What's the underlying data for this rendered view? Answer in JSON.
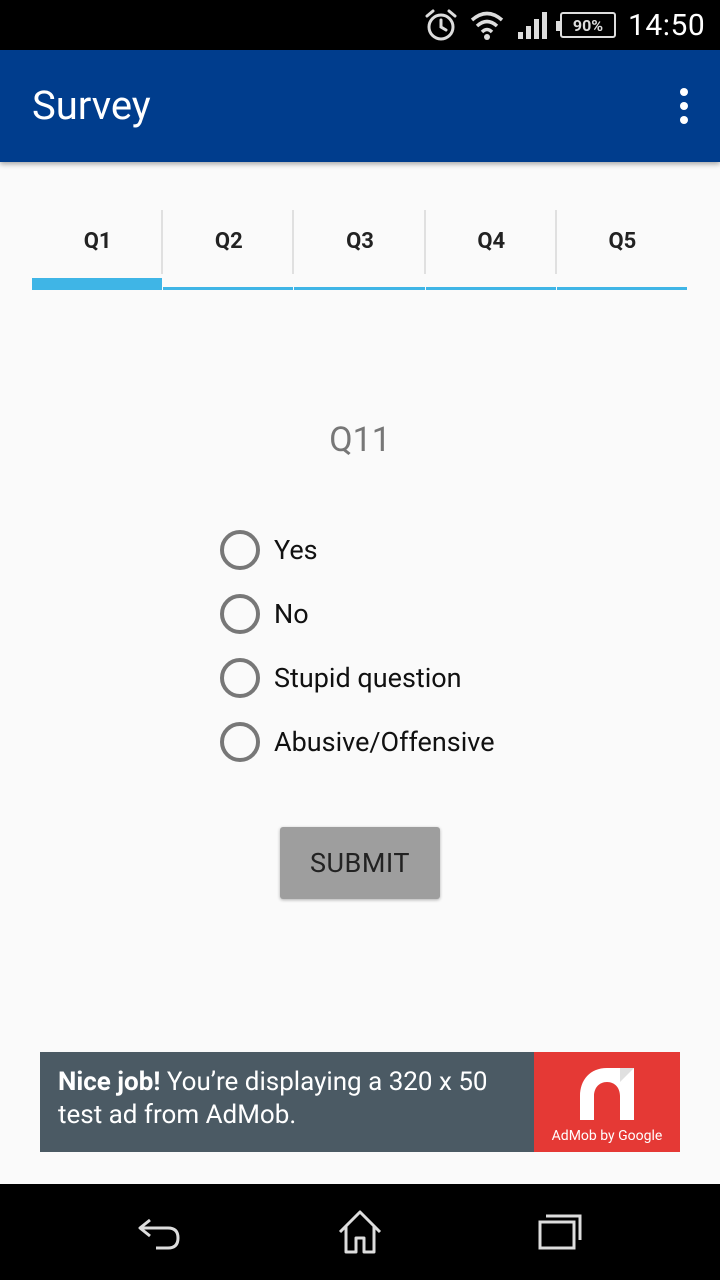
{
  "status_bar": {
    "time": "14:50",
    "battery": "90%",
    "icons": [
      "alarm-icon",
      "wifi-icon",
      "signal-icon",
      "battery-icon"
    ]
  },
  "app_bar": {
    "title": "Survey",
    "menu_icon": "overflow-menu-icon",
    "color": "#003d8d"
  },
  "tabs": [
    {
      "label": "Q1",
      "active": true
    },
    {
      "label": "Q2",
      "active": false
    },
    {
      "label": "Q3",
      "active": false
    },
    {
      "label": "Q4",
      "active": false
    },
    {
      "label": "Q5",
      "active": false
    }
  ],
  "tab_accent": "#3fb5e6",
  "question": {
    "title": "Q11",
    "options": [
      {
        "label": "Yes",
        "selected": false
      },
      {
        "label": "No",
        "selected": false
      },
      {
        "label": "Stupid question",
        "selected": false
      },
      {
        "label": "Abusive/Offensive",
        "selected": false
      }
    ]
  },
  "submit": {
    "label": "SUBMIT"
  },
  "ad": {
    "headline": "Nice job!",
    "body": " You’re displaying a 320 x 50 test ad from AdMob.",
    "logo_caption": "AdMob by Google"
  },
  "nav_bar": {
    "icons": [
      "back-icon",
      "home-icon",
      "recent-apps-icon"
    ]
  }
}
